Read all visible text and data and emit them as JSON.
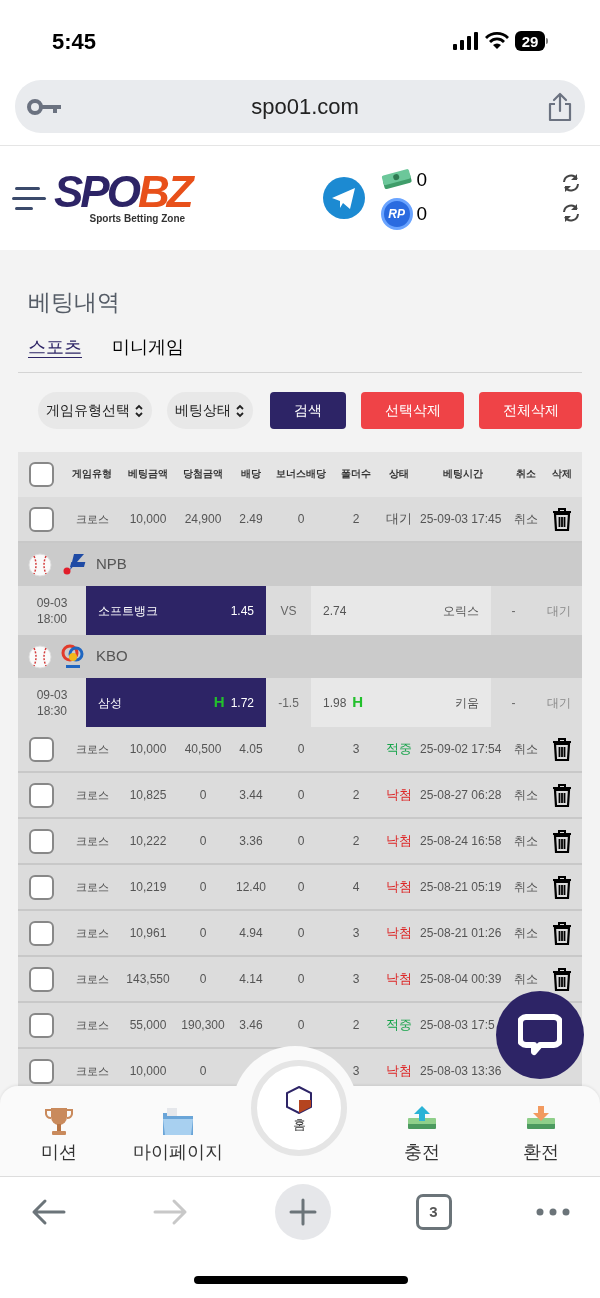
{
  "status_bar": {
    "time": "5:45",
    "battery": "29"
  },
  "browser": {
    "url": "spo01.com",
    "tab_count": "3"
  },
  "header": {
    "logo": {
      "part_1": "SPO",
      "part_2": "BZ",
      "tagline": "Sports Betting Zone"
    },
    "balances": [
      {
        "kind": "cash",
        "amount": "0"
      },
      {
        "kind": "rp",
        "badge": "RP",
        "amount": "0"
      }
    ]
  },
  "page_title": "베팅내역",
  "tabs": [
    {
      "label": "스포츠",
      "selected": true
    },
    {
      "label": "미니게임",
      "selected": false
    }
  ],
  "filters": {
    "selects": [
      "게임유형선택",
      "베팅상태"
    ],
    "buttons": [
      {
        "label": "검색",
        "kind": "primary"
      },
      {
        "label": "선택삭제",
        "kind": "danger"
      },
      {
        "label": "전체삭제",
        "kind": "danger"
      }
    ]
  },
  "table": {
    "select_all_checked": false,
    "columns": [
      "게임유형",
      "베팅금액",
      "당첨금액",
      "배당",
      "보너스배당",
      "폴더수",
      "상태",
      "베팅시간",
      "취소",
      "삭제"
    ],
    "rows": [
      {
        "kind": "bet",
        "checked": false,
        "type": "크로스",
        "stake": "10,000",
        "payout": "24,900",
        "odds": "2.49",
        "bonus": "0",
        "folders": "2",
        "status": "대기",
        "color": "#555555",
        "time": "25-09-03 17:45",
        "cancel": "취소",
        "delete": true
      },
      {
        "kind": "league",
        "icons": [
          {
            "kind": "baseball"
          },
          {
            "kind": "npb"
          }
        ],
        "name": "NPB"
      },
      {
        "kind": "match",
        "date": "09-03",
        "clock": "18:00",
        "home": {
          "name": "소프트뱅크",
          "odds": "1.45",
          "selected": true
        },
        "middle": "VS",
        "away": {
          "odds": "2.74",
          "name": "오릭스",
          "selected": false
        },
        "result": "-",
        "status": "대기"
      },
      {
        "kind": "league",
        "icons": [
          {
            "kind": "baseball"
          },
          {
            "kind": "kbo"
          }
        ],
        "name": "KBO"
      },
      {
        "kind": "match",
        "date": "09-03",
        "clock": "18:30",
        "home": {
          "name": "삼성",
          "mark": "H",
          "odds": "1.72",
          "selected": true
        },
        "middle": "-1.5",
        "away": {
          "odds": "1.98",
          "mark": "H",
          "name": "키움",
          "selected": false
        },
        "result": "-",
        "status": "대기"
      },
      {
        "kind": "bet",
        "checked": false,
        "type": "크로스",
        "stake": "10,000",
        "payout": "40,500",
        "odds": "4.05",
        "bonus": "0",
        "folders": "3",
        "status": "적중",
        "color": "#16a34a",
        "time": "25-09-02 17:54",
        "cancel": "취소",
        "delete": true
      },
      {
        "kind": "bet",
        "checked": false,
        "type": "크로스",
        "stake": "10,825",
        "payout": "0",
        "odds": "3.44",
        "bonus": "0",
        "folders": "2",
        "status": "낙첨",
        "color": "#dc2626",
        "time": "25-08-27 06:28",
        "cancel": "취소",
        "delete": true
      },
      {
        "kind": "bet",
        "checked": false,
        "type": "크로스",
        "stake": "10,222",
        "payout": "0",
        "odds": "3.36",
        "bonus": "0",
        "folders": "2",
        "status": "낙첨",
        "color": "#dc2626",
        "time": "25-08-24 16:58",
        "cancel": "취소",
        "delete": true
      },
      {
        "kind": "bet",
        "checked": false,
        "type": "크로스",
        "stake": "10,219",
        "payout": "0",
        "odds": "12.40",
        "bonus": "0",
        "folders": "4",
        "status": "낙첨",
        "color": "#dc2626",
        "time": "25-08-21 05:19",
        "cancel": "취소",
        "delete": true
      },
      {
        "kind": "bet",
        "checked": false,
        "type": "크로스",
        "stake": "10,961",
        "payout": "0",
        "odds": "4.94",
        "bonus": "0",
        "folders": "3",
        "status": "낙첨",
        "color": "#dc2626",
        "time": "25-08-21 01:26",
        "cancel": "취소",
        "delete": true
      },
      {
        "kind": "bet",
        "checked": false,
        "type": "크로스",
        "stake": "143,550",
        "payout": "0",
        "odds": "4.14",
        "bonus": "0",
        "folders": "3",
        "status": "낙첨",
        "color": "#dc2626",
        "time": "25-08-04 00:39",
        "cancel": "취소",
        "delete": true
      },
      {
        "kind": "bet",
        "checked": false,
        "type": "크로스",
        "stake": "55,000",
        "payout": "190,300",
        "odds": "3.46",
        "bonus": "0",
        "folders": "2",
        "status": "적중",
        "color": "#16a34a",
        "time": "25-08-03 17:5",
        "delete": false
      },
      {
        "kind": "bet",
        "checked": false,
        "type": "크로스",
        "stake": "10,000",
        "payout": "0",
        "folders": "3",
        "status": "낙첨",
        "color": "#dc2626",
        "time": "25-08-03 13:36",
        "delete": false
      }
    ]
  },
  "bottom_nav": [
    {
      "kind": "trophy",
      "label": "미션"
    },
    {
      "kind": "folder",
      "label": "마이페이지"
    },
    {
      "kind": "home",
      "label": "홈"
    },
    {
      "kind": "deposit",
      "label": "충전"
    },
    {
      "kind": "withdraw",
      "label": "환전"
    }
  ]
}
